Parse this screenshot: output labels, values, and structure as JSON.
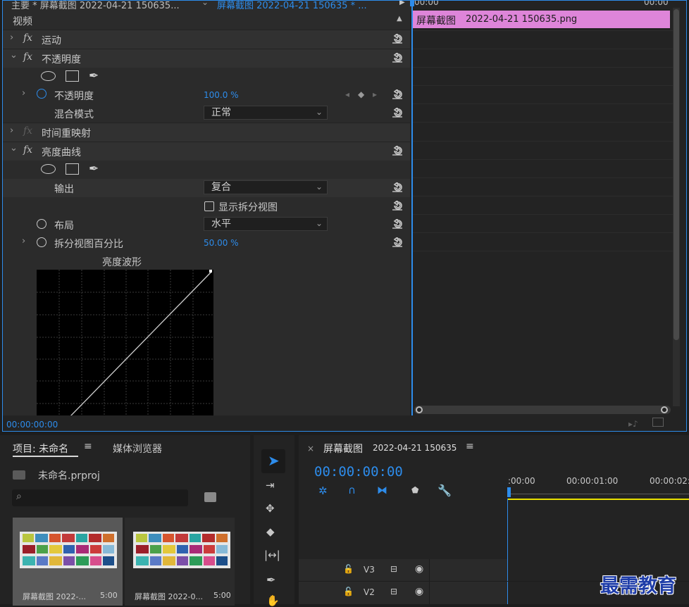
{
  "effect_controls": {
    "tab_main": "主要 * 屏幕截图 2022-04-21 150635...",
    "tab_clip": "屏幕截图 2022-04-21 150635 * ...",
    "section_title": "视频",
    "effects": [
      {
        "label": "运动"
      },
      {
        "label": "不透明度"
      },
      {
        "label": "时间重映射"
      },
      {
        "label": "亮度曲线"
      }
    ],
    "opacity": {
      "label": "不透明度",
      "value": "100.0 %"
    },
    "blend_mode": {
      "label": "混合模式",
      "value": "正常"
    },
    "output": {
      "label": "输出",
      "value": "复合"
    },
    "split_view": {
      "label": "显示拆分视图"
    },
    "layout": {
      "label": "布局",
      "value": "水平"
    },
    "split_percent": {
      "label": "拆分视图百分比",
      "value": "50.00 %"
    },
    "waveform_title": "亮度波形",
    "timecode": "00:00:00:00",
    "ruler_left": "00:00",
    "ruler_right": "00:00"
  },
  "mini_timeline": {
    "clip_name": "屏幕截图",
    "clip_detail": "2022-04-21  150635.png",
    "clip_color": "#de85d9"
  },
  "project": {
    "tab_project": "项目: 未命名",
    "tab_media": "媒体浏览器",
    "file_name": "未命名.prproj",
    "items": [
      {
        "name": "屏幕截图 2022-...",
        "duration": "5:00"
      },
      {
        "name": "屏幕截图 2022-0...",
        "duration": "5:00"
      }
    ]
  },
  "timeline": {
    "title": "屏幕截图",
    "title_detail": "2022-04-21 150635",
    "timecode": "00:00:00:00",
    "ruler": [
      ":00:00",
      "00:00:01:00",
      "00:00:02:"
    ],
    "tracks": [
      {
        "name": "V3"
      },
      {
        "name": "V2"
      }
    ]
  },
  "watermark": "最需教育",
  "colors": {
    "accent": "#2d8ceb",
    "clip": "#de85d9",
    "work_area": "#e8e000"
  }
}
